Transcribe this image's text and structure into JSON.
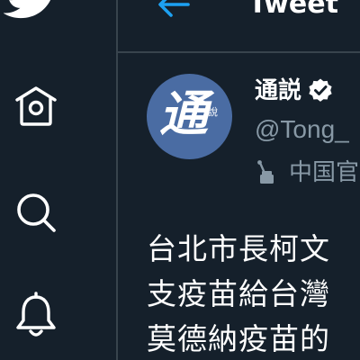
{
  "app": {
    "nav": {
      "logo_icon": "twitter-bird-icon",
      "items": [
        {
          "icon": "home-icon"
        },
        {
          "icon": "search-icon"
        },
        {
          "icon": "bell-icon"
        }
      ]
    },
    "header": {
      "back_icon": "arrow-left-icon",
      "title": "Tweet"
    }
  },
  "tweet": {
    "avatar": {
      "main_char": "通",
      "sub_chars": "說"
    },
    "author": {
      "display_name": "通説",
      "verified_icon": "verified-badge-icon",
      "handle": "@Tong_",
      "affiliation_icon": "microphone-icon",
      "affiliation": "中国官"
    },
    "text_lines": [
      "台北市長柯文",
      "支疫苗給台灣",
      "莫德納疫苗的"
    ]
  },
  "colors": {
    "background": "#15202b",
    "divider": "#38444d",
    "accent": "#1da1f2",
    "secondary_text": "#8899a6",
    "avatar_bg": "#4a6ca3"
  }
}
